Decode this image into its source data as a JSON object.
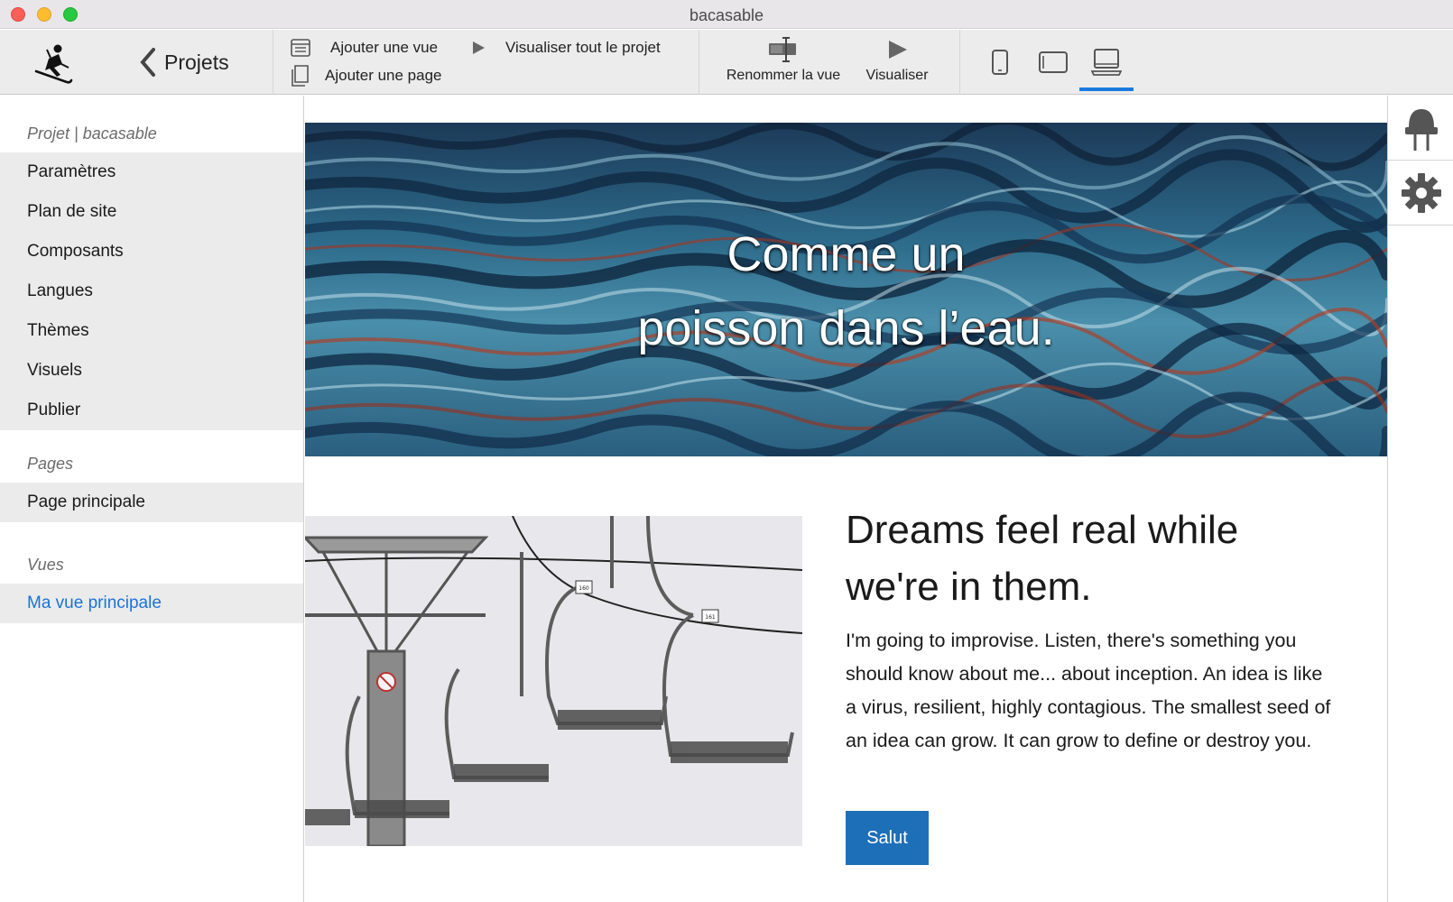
{
  "window": {
    "title": "bacasable"
  },
  "toolbar": {
    "back_label": "Projets",
    "add_view": "Ajouter une vue",
    "add_page": "Ajouter une page",
    "preview_all": "Visualiser tout le projet",
    "rename_view": "Renommer la vue",
    "preview": "Visualiser",
    "devices": [
      "phone",
      "tablet",
      "desktop"
    ],
    "active_device": "desktop",
    "accent_color": "#1a7ae0"
  },
  "sidebar": {
    "project_title": "Projet | bacasable",
    "project_items": [
      {
        "label": "Paramètres"
      },
      {
        "label": "Plan de site"
      },
      {
        "label": "Composants"
      },
      {
        "label": "Langues"
      },
      {
        "label": "Thèmes"
      },
      {
        "label": "Visuels"
      },
      {
        "label": "Publier"
      }
    ],
    "pages_title": "Pages",
    "pages": [
      {
        "label": "Page principale"
      }
    ],
    "views_title": "Vues",
    "views": [
      {
        "label": "Ma vue principale",
        "current": true
      }
    ]
  },
  "canvas": {
    "hero_line1": "Comme un",
    "hero_line2": "poisson dans l’eau.",
    "heading_line1": "Dreams feel real while",
    "heading_line2": "we're in them.",
    "body": "I'm going to improvise. Listen, there's something you should know about me... about inception. An idea is like a virus, resilient, highly contagious. The smallest seed of an idea can grow. It can grow to define or destroy you.",
    "button_label": "Salut",
    "button_color": "#1d6fb8",
    "chair_numbers": [
      "160",
      "161"
    ]
  },
  "right_panel": {
    "icons": [
      "plug-icon",
      "gear-icon"
    ]
  }
}
